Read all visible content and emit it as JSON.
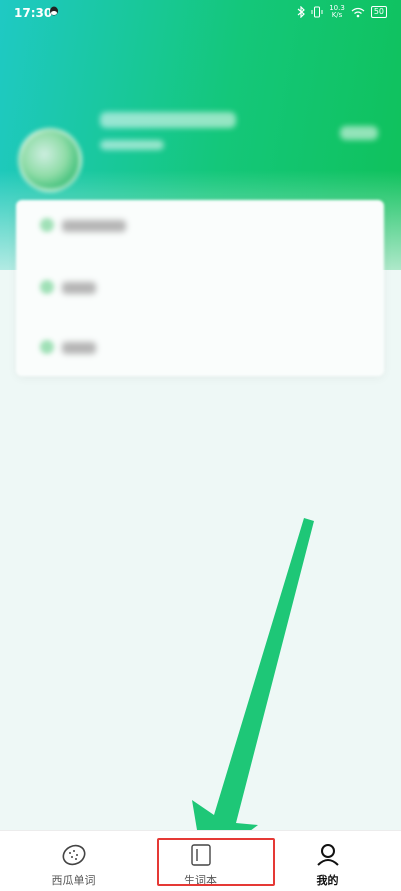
{
  "status_bar": {
    "time": "17:30",
    "network_speed_top": "10.3",
    "network_speed_bottom": "K/s",
    "battery": "50"
  },
  "tabs": [
    {
      "label": "西瓜单词",
      "icon": "watermelon-icon"
    },
    {
      "label": "生词本",
      "icon": "notebook-icon"
    },
    {
      "label": "我的",
      "icon": "person-icon"
    }
  ],
  "colors": {
    "header_start": "#1fc9c4",
    "header_end": "#0fc15a",
    "arrow": "#1ec777",
    "highlight": "#e53935"
  }
}
